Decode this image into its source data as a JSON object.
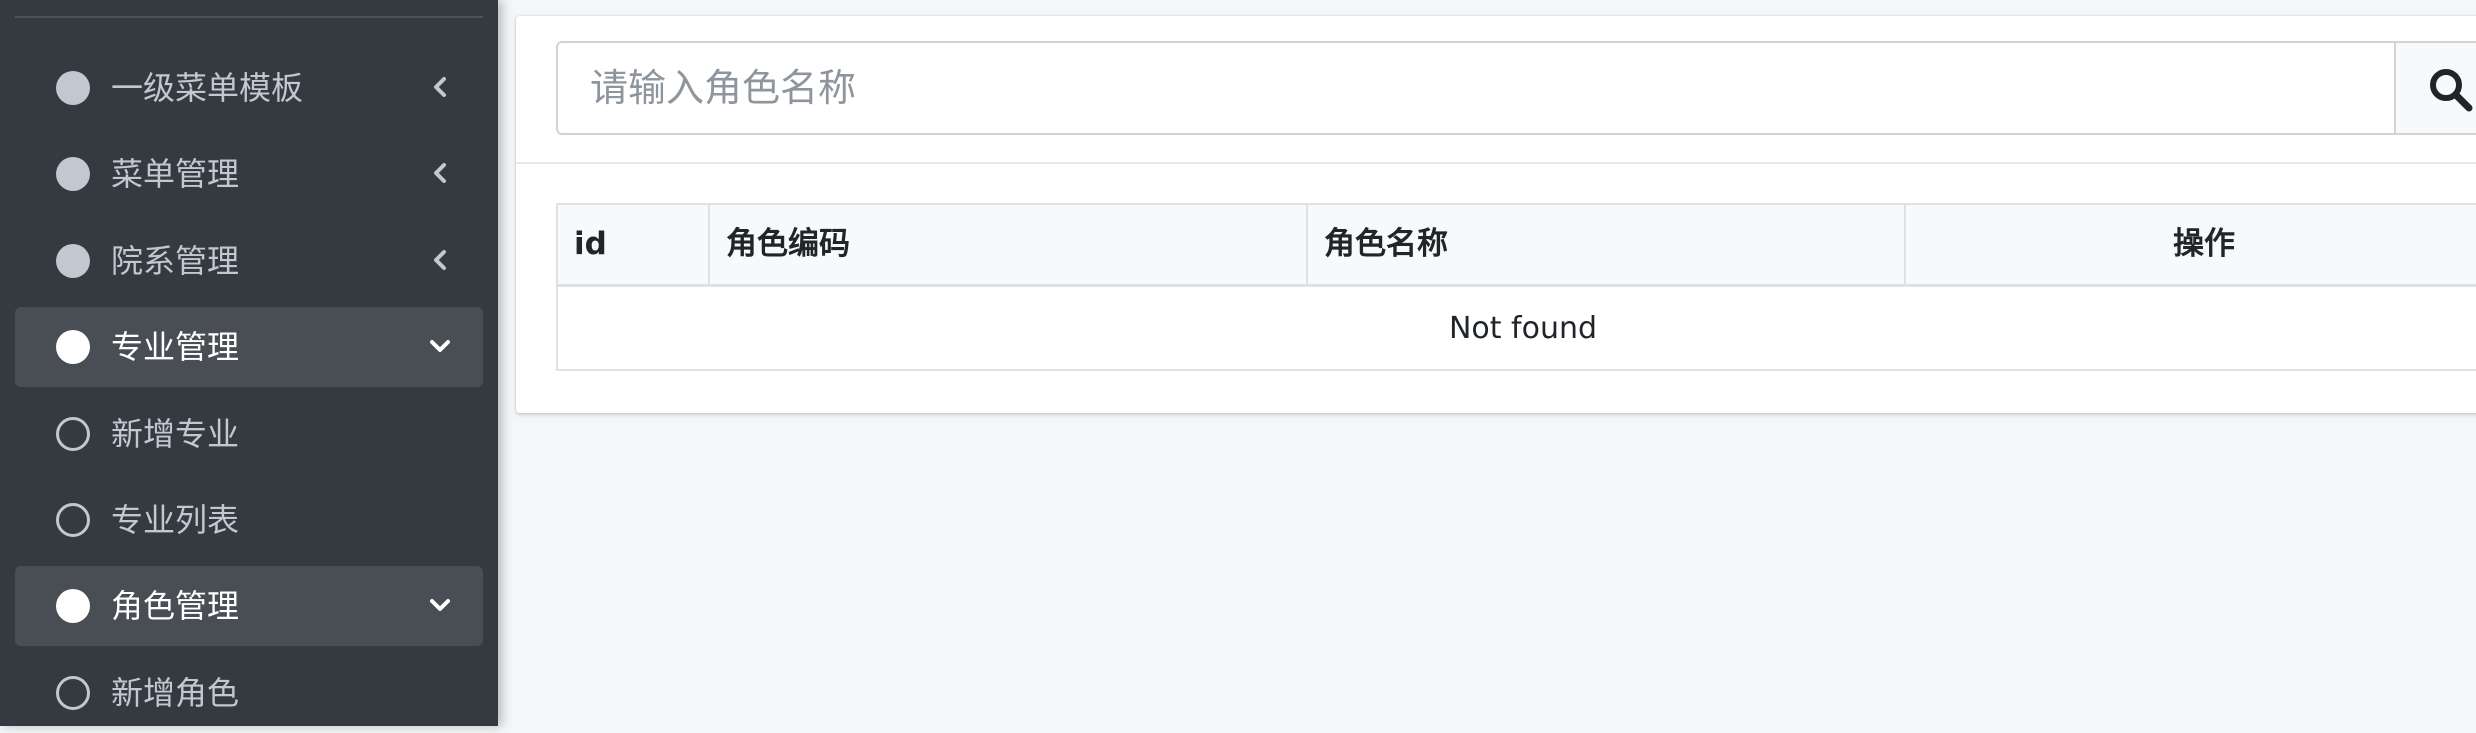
{
  "sidebar": {
    "items": [
      {
        "label": "一级菜单模板",
        "icon": "circle-icon",
        "chevron": "chevron-left-icon",
        "active": false
      },
      {
        "label": "菜单管理",
        "icon": "circle-icon",
        "chevron": "chevron-left-icon",
        "active": false
      },
      {
        "label": "院系管理",
        "icon": "circle-icon",
        "chevron": "chevron-left-icon",
        "active": false
      },
      {
        "label": "专业管理",
        "icon": "circle-icon",
        "chevron": "chevron-down-icon",
        "active": true
      },
      {
        "label": "新增专业",
        "icon": "circle-outline-icon",
        "active": false
      },
      {
        "label": "专业列表",
        "icon": "circle-outline-icon",
        "active": false
      },
      {
        "label": "角色管理",
        "icon": "circle-icon",
        "chevron": "chevron-down-icon",
        "active": true
      },
      {
        "label": "新增角色",
        "icon": "circle-outline-icon",
        "active": false
      }
    ]
  },
  "search": {
    "placeholder": "请输入角色名称",
    "value": "",
    "button_icon": "search-icon"
  },
  "table": {
    "columns": [
      "id",
      "角色编码",
      "角色名称",
      "操作"
    ],
    "rows": [],
    "empty_text": "Not found"
  },
  "colors": {
    "sidebar_bg": "#343a40",
    "sidebar_text": "#c2c7d0",
    "active_text": "#ffffff",
    "content_bg": "#f4f6f9"
  }
}
